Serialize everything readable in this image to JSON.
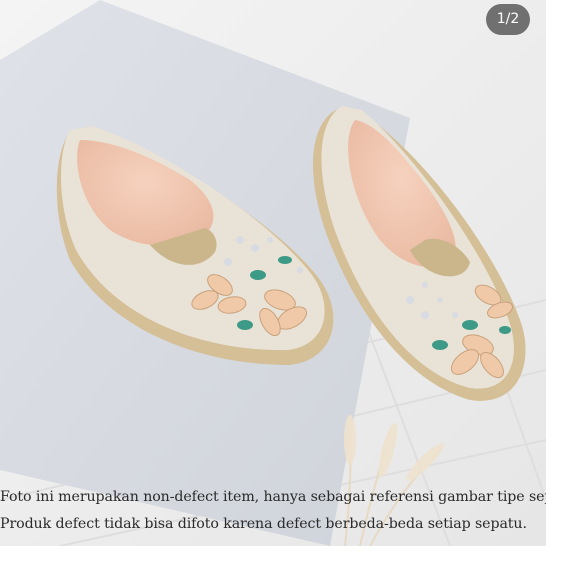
{
  "viewer": {
    "image_counter": "1/2",
    "image_description_icon": "product-photo",
    "caption_lines": [
      "Foto ini merupakan non-defect item, hanya sebagai referensi gambar tipe sepatu.",
      "Produk defect tidak bisa difoto karena defect berbeda-beda setiap sepatu."
    ]
  },
  "colors": {
    "background": "#ececec",
    "tile": "#d9dde3",
    "shoe_canvas": "#e8e0d2",
    "insole": "#f1c9b4",
    "jute": "#d4bf96",
    "counter_bg": "#464646"
  }
}
